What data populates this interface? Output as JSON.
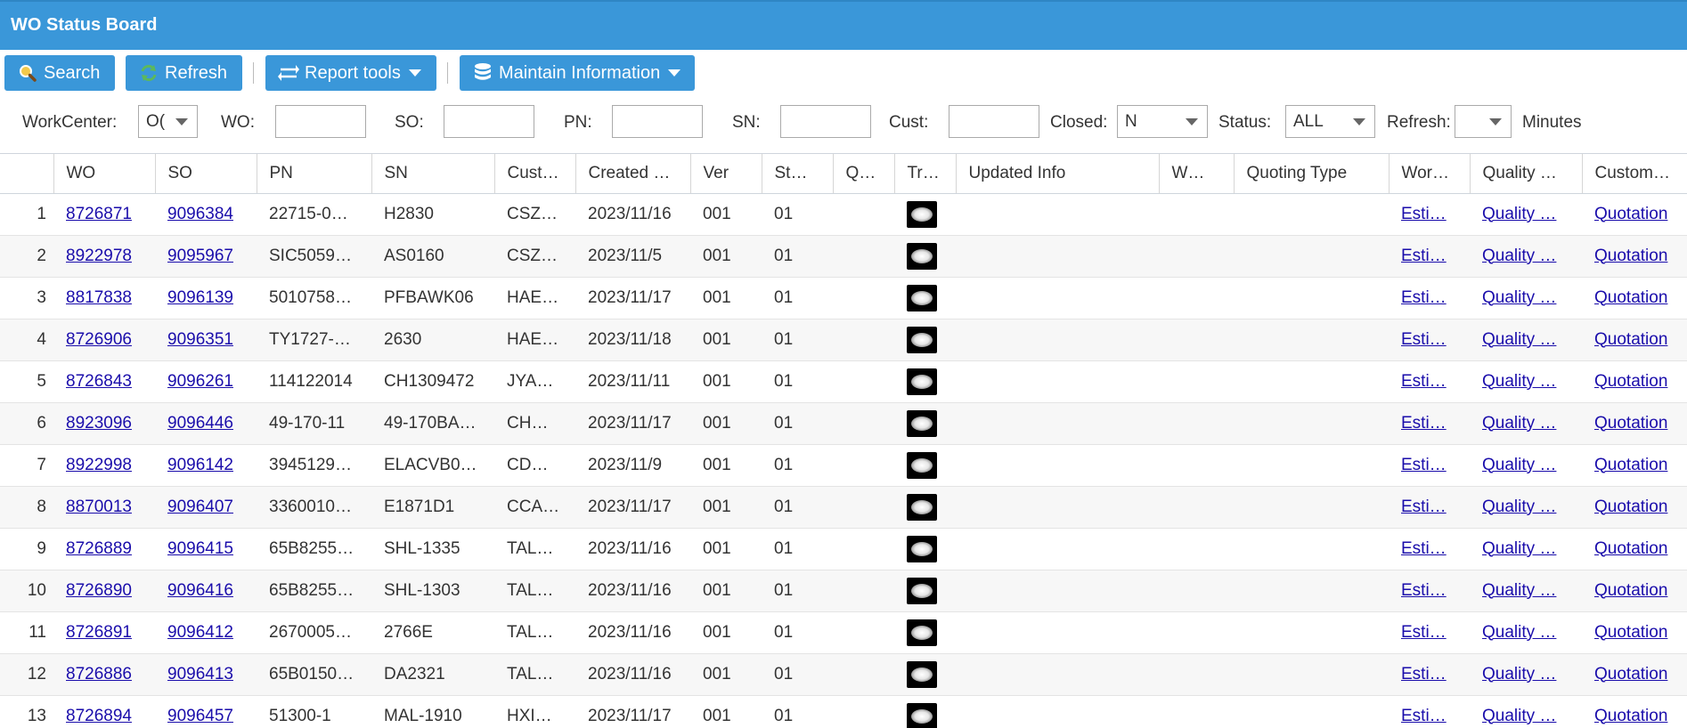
{
  "app": {
    "title": "WO Status Board"
  },
  "toolbar": {
    "search_label": "Search",
    "refresh_label": "Refresh",
    "report_tools_label": "Report tools",
    "maintain_info_label": "Maintain Information"
  },
  "filters": {
    "workcenter_label": "WorkCenter:",
    "workcenter_value": "O(",
    "wo_label": "WO:",
    "so_label": "SO:",
    "pn_label": "PN:",
    "sn_label": "SN:",
    "cust_label": "Cust:",
    "closed_label": "Closed:",
    "closed_value": "N",
    "status_label": "Status:",
    "status_value": "ALL",
    "refresh_label": "Refresh:",
    "refresh_value": "",
    "minutes_label": "Minutes"
  },
  "table": {
    "headers": {
      "wo": "WO",
      "so": "SO",
      "pn": "PN",
      "sn": "SN",
      "cust": "Cust…",
      "created": "Created …",
      "ver": "Ver",
      "st": "St…",
      "q": "Q…",
      "tr": "Tr…",
      "updated": "Updated Info",
      "w": "W…",
      "quoting": "Quoting Type",
      "wor": "Wor…",
      "quality": "Quality …",
      "customer": "Customer…"
    },
    "link_labels": {
      "estimate": "Esti…",
      "quality": "Quality …",
      "quotation": "Quotation"
    },
    "rows": [
      {
        "n": "1",
        "wo": "8726871",
        "so": "9096384",
        "pn": "22715-0…",
        "sn": "H2830",
        "cust": "CSZ…",
        "created": "2023/11/16",
        "ver": "001",
        "st": "01"
      },
      {
        "n": "2",
        "wo": "8922978",
        "so": "9095967",
        "pn": "SIC5059…",
        "sn": "AS0160",
        "cust": "CSZ…",
        "created": "2023/11/5",
        "ver": "001",
        "st": "01"
      },
      {
        "n": "3",
        "wo": "8817838",
        "so": "9096139",
        "pn": "5010758…",
        "sn": "PFBAWK06",
        "cust": "HAE…",
        "created": "2023/11/17",
        "ver": "001",
        "st": "01"
      },
      {
        "n": "4",
        "wo": "8726906",
        "so": "9096351",
        "pn": "TY1727-…",
        "sn": "2630",
        "cust": "HAE…",
        "created": "2023/11/18",
        "ver": "001",
        "st": "01"
      },
      {
        "n": "5",
        "wo": "8726843",
        "so": "9096261",
        "pn": "114122014",
        "sn": "CH1309472",
        "cust": "JYA…",
        "created": "2023/11/11",
        "ver": "001",
        "st": "01"
      },
      {
        "n": "6",
        "wo": "8923096",
        "so": "9096446",
        "pn": "49-170-11",
        "sn": "49-170BA…",
        "cust": "CH…",
        "created": "2023/11/17",
        "ver": "001",
        "st": "01"
      },
      {
        "n": "7",
        "wo": "8922998",
        "so": "9096142",
        "pn": "3945129…",
        "sn": "ELACVB0…",
        "cust": "CD…",
        "created": "2023/11/9",
        "ver": "001",
        "st": "01"
      },
      {
        "n": "8",
        "wo": "8870013",
        "so": "9096407",
        "pn": "3360010…",
        "sn": "E1871D1",
        "cust": "CCA…",
        "created": "2023/11/17",
        "ver": "001",
        "st": "01"
      },
      {
        "n": "9",
        "wo": "8726889",
        "so": "9096415",
        "pn": "65B8255…",
        "sn": "SHL-1335",
        "cust": "TAL…",
        "created": "2023/11/16",
        "ver": "001",
        "st": "01"
      },
      {
        "n": "10",
        "wo": "8726890",
        "so": "9096416",
        "pn": "65B8255…",
        "sn": "SHL-1303",
        "cust": "TAL…",
        "created": "2023/11/16",
        "ver": "001",
        "st": "01"
      },
      {
        "n": "11",
        "wo": "8726891",
        "so": "9096412",
        "pn": "2670005…",
        "sn": "2766E",
        "cust": "TAL…",
        "created": "2023/11/16",
        "ver": "001",
        "st": "01"
      },
      {
        "n": "12",
        "wo": "8726886",
        "so": "9096413",
        "pn": "65B0150…",
        "sn": "DA2321",
        "cust": "TAL…",
        "created": "2023/11/16",
        "ver": "001",
        "st": "01"
      },
      {
        "n": "13",
        "wo": "8726894",
        "so": "9096457",
        "pn": "51300-1",
        "sn": "MAL-1910",
        "cust": "HXI…",
        "created": "2023/11/17",
        "ver": "001",
        "st": "01"
      }
    ]
  },
  "colors": {
    "header_blue": "#3a97d9",
    "link": "#1a0dab"
  }
}
